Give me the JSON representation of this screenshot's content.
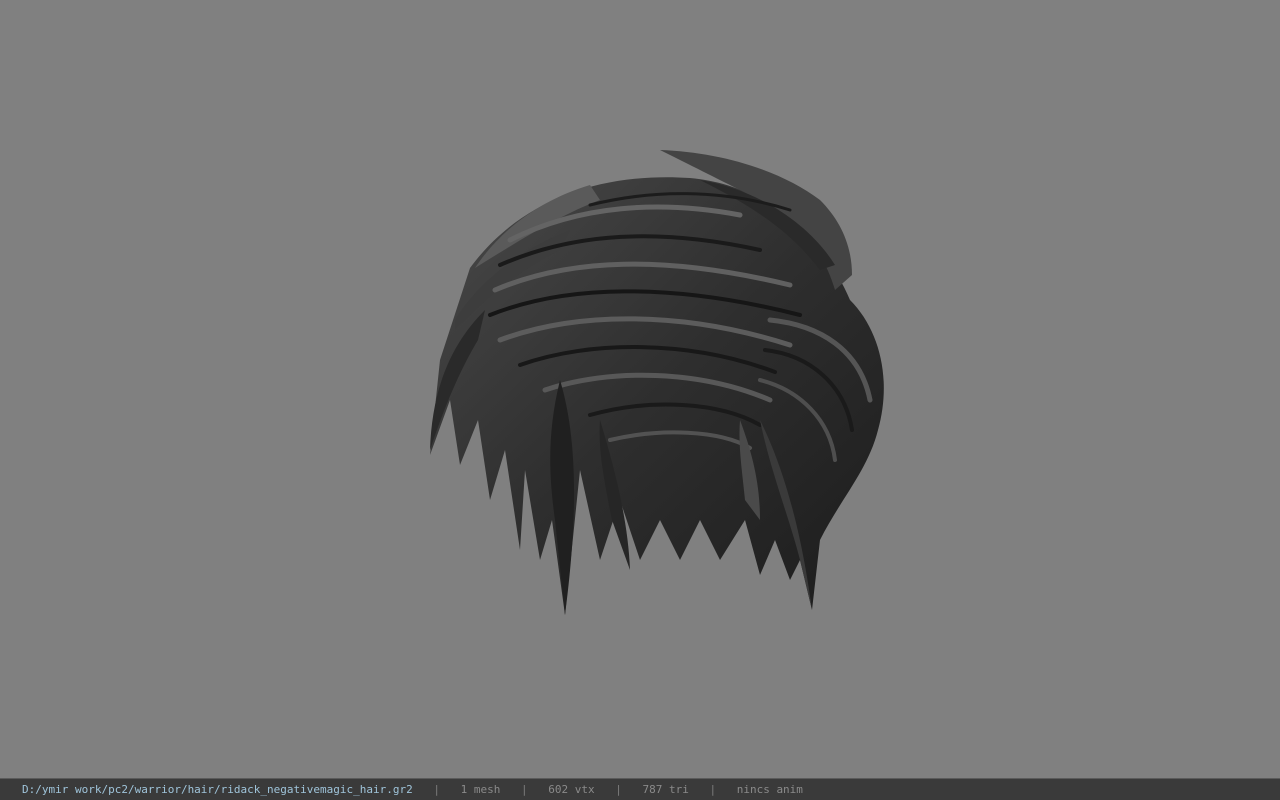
{
  "viewport": {
    "background_color": "#808080",
    "model_name": "hair-mesh"
  },
  "status_bar": {
    "file_path": "D:/ymir work/pc2/warrior/hair/ridack_negativemagic_hair.gr2",
    "separator": "|",
    "mesh_count": "1 mesh",
    "vertex_count": "602 vtx",
    "triangle_count": "787 tri",
    "anim_label": "nincs anim"
  },
  "colors": {
    "status_background": "#3a3a3a",
    "path_text": "#9fc4da",
    "stat_text": "#8a8a8a",
    "hair_dark": "#1a1a1a",
    "hair_mid": "#3c3c3c",
    "hair_light": "#5e5e5e"
  }
}
